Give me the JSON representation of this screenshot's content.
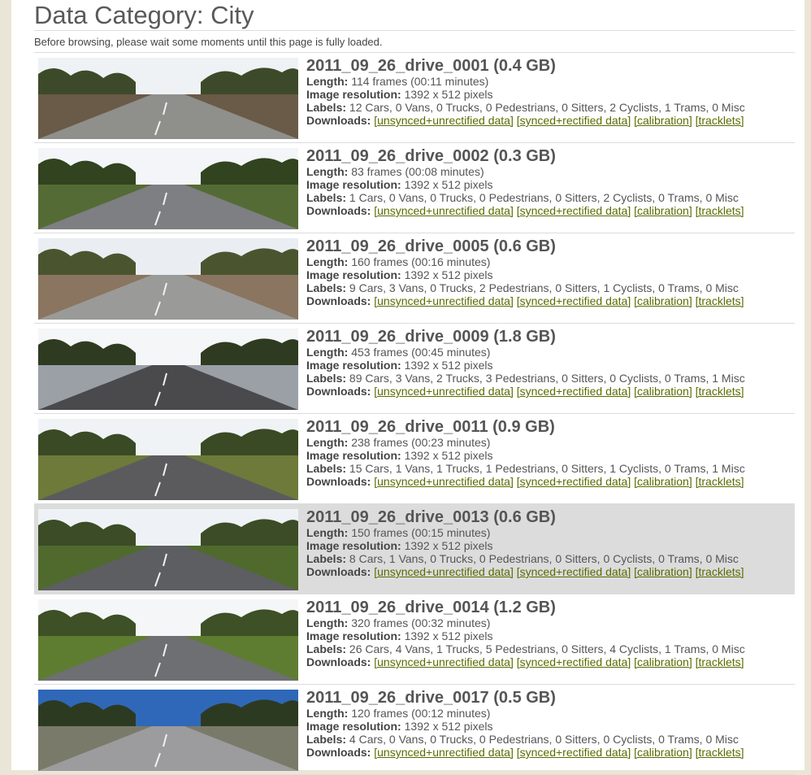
{
  "page": {
    "title": "Data Category: City",
    "notice": "Before browsing, please wait some moments until this page is fully loaded."
  },
  "labels": {
    "length": "Length:",
    "resolution": "Image resolution:",
    "labels": "Labels:",
    "downloads": "Downloads:"
  },
  "links": {
    "unsynced": "[unsynced+unrectified data]",
    "synced": "[synced+rectified data]",
    "calibration": "[calibration]",
    "tracklets": "[tracklets]"
  },
  "drives": [
    {
      "title": "2011_09_26_drive_0001 (0.4 GB)",
      "length": "114 frames (00:11 minutes)",
      "resolution": "1392 x 512 pixels",
      "labels": "12 Cars, 0 Vans, 0 Trucks, 0 Pedestrians, 0 Sitters, 2 Cyclists, 1 Trams, 0 Misc",
      "sky": "#eef2f5",
      "trees": "#3d4a2a",
      "road": "#8f8f8c",
      "ground": "#6a5a48",
      "highlight": false
    },
    {
      "title": "2011_09_26_drive_0002 (0.3 GB)",
      "length": "83 frames (00:08 minutes)",
      "resolution": "1392 x 512 pixels",
      "labels": "1 Cars, 0 Vans, 0 Trucks, 0 Pedestrians, 0 Sitters, 2 Cyclists, 0 Trams, 0 Misc",
      "sky": "#f3f5f8",
      "trees": "#31431f",
      "road": "#7d7f82",
      "ground": "#556b36",
      "highlight": false
    },
    {
      "title": "2011_09_26_drive_0005 (0.6 GB)",
      "length": "160 frames (00:16 minutes)",
      "resolution": "1392 x 512 pixels",
      "labels": "9 Cars, 3 Vans, 0 Trucks, 2 Pedestrians, 0 Sitters, 1 Cyclists, 0 Trams, 0 Misc",
      "sky": "#eaeef2",
      "trees": "#4a5530",
      "road": "#9a9a98",
      "ground": "#8a7560",
      "highlight": false
    },
    {
      "title": "2011_09_26_drive_0009 (1.8 GB)",
      "length": "453 frames (00:45 minutes)",
      "resolution": "1392 x 512 pixels",
      "labels": "89 Cars, 3 Vans, 2 Trucks, 3 Pedestrians, 0 Sitters, 0 Cyclists, 0 Trams, 1 Misc",
      "sky": "#f4f6f8",
      "trees": "#2e3b20",
      "road": "#4a4a4c",
      "ground": "#9aa0a6",
      "highlight": false
    },
    {
      "title": "2011_09_26_drive_0011 (0.9 GB)",
      "length": "238 frames (00:23 minutes)",
      "resolution": "1392 x 512 pixels",
      "labels": "15 Cars, 1 Vans, 1 Trucks, 1 Pedestrians, 0 Sitters, 1 Cyclists, 0 Trams, 1 Misc",
      "sky": "#f0f3f6",
      "trees": "#3a4a24",
      "road": "#5b5b5e",
      "ground": "#6d7a3a",
      "highlight": false
    },
    {
      "title": "2011_09_26_drive_0013 (0.6 GB)",
      "length": "150 frames (00:15 minutes)",
      "resolution": "1392 x 512 pixels",
      "labels": "8 Cars, 1 Vans, 0 Trucks, 0 Pedestrians, 0 Sitters, 0 Cyclists, 0 Trams, 0 Misc",
      "sky": "#eef2f6",
      "trees": "#3b4c26",
      "road": "#5d5e62",
      "ground": "#4f6a2c",
      "highlight": true
    },
    {
      "title": "2011_09_26_drive_0014 (1.2 GB)",
      "length": "320 frames (00:32 minutes)",
      "resolution": "1392 x 512 pixels",
      "labels": "26 Cars, 4 Vans, 1 Trucks, 5 Pedestrians, 0 Sitters, 4 Cyclists, 1 Trams, 0 Misc",
      "sky": "#f5f6f8",
      "trees": "#3d5026",
      "road": "#6e6f72",
      "ground": "#5f7d30",
      "highlight": false
    },
    {
      "title": "2011_09_26_drive_0017 (0.5 GB)",
      "length": "120 frames (00:12 minutes)",
      "resolution": "1392 x 512 pixels",
      "labels": "4 Cars, 0 Vans, 0 Trucks, 0 Pedestrians, 0 Sitters, 0 Cyclists, 0 Trams, 0 Misc",
      "sky": "#2f68b8",
      "trees": "#2d3a22",
      "road": "#9c9c9e",
      "ground": "#7a7a6a",
      "highlight": false
    }
  ]
}
